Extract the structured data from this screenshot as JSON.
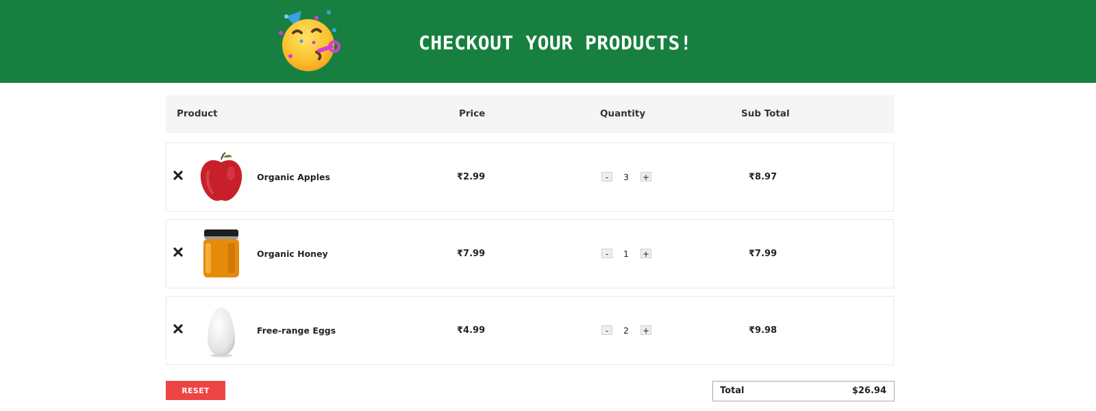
{
  "header": {
    "title": "CHECKOUT YOUR PRODUCTS!",
    "emoji_icon": "party-face-icon",
    "background_color": "#178040"
  },
  "table": {
    "columns": [
      "Product",
      "Price",
      "Quantity",
      "Sub Total"
    ]
  },
  "items": [
    {
      "name": "Organic Apples",
      "price": "₹2.99",
      "quantity": "3",
      "subtotal": "₹8.97",
      "image_icon": "red-apple-image"
    },
    {
      "name": "Organic Honey",
      "price": "₹7.99",
      "quantity": "1",
      "subtotal": "₹7.99",
      "image_icon": "honey-jar-image"
    },
    {
      "name": "Free-range Eggs",
      "price": "₹4.99",
      "quantity": "2",
      "subtotal": "₹9.98",
      "image_icon": "white-egg-image"
    }
  ],
  "qty_controls": {
    "minus": "-",
    "plus": "+"
  },
  "footer": {
    "reset_label": "RESET",
    "total_label": "Total",
    "total_value": "$26.94",
    "reset_color": "#ef4444"
  }
}
